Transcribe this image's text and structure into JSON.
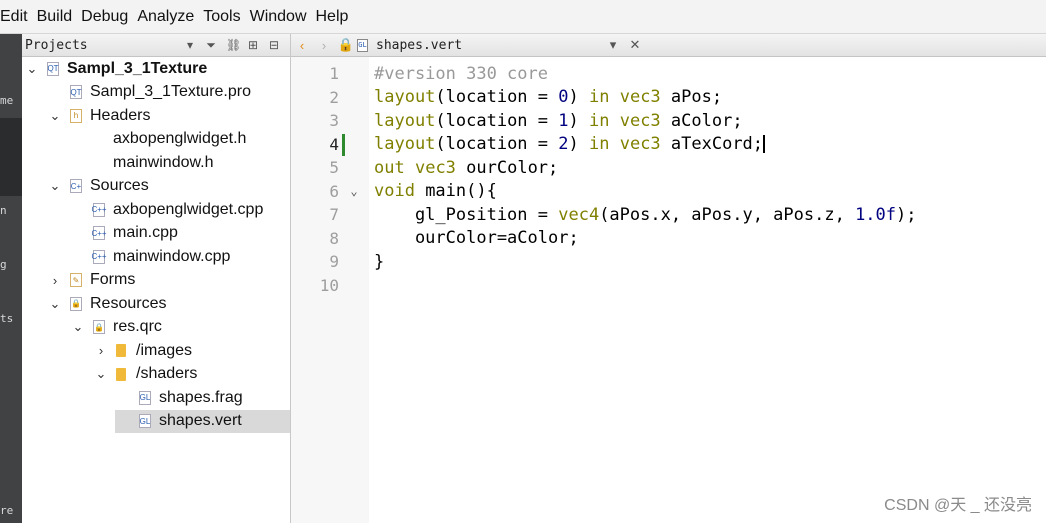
{
  "menu": [
    "Edit",
    "Build",
    "Debug",
    "Analyze",
    "Tools",
    "Window",
    "Help"
  ],
  "modes": [
    "me",
    "n",
    "g",
    "ts",
    "re"
  ],
  "projects_panel": {
    "title": "Projects",
    "tree": [
      {
        "level": 0,
        "arrow": "⌄",
        "icon": "project",
        "label": "Sampl_3_1Texture",
        "bold": true
      },
      {
        "level": 1,
        "arrow": "",
        "icon": "pro",
        "label": "Sampl_3_1Texture.pro"
      },
      {
        "level": 1,
        "arrow": "⌄",
        "icon": "header",
        "label": "Headers"
      },
      {
        "level": 2,
        "arrow": "",
        "icon": "",
        "label": "axbopenglwidget.h"
      },
      {
        "level": 2,
        "arrow": "",
        "icon": "",
        "label": "mainwindow.h"
      },
      {
        "level": 1,
        "arrow": "⌄",
        "icon": "source",
        "label": "Sources"
      },
      {
        "level": 2,
        "arrow": "",
        "icon": "cpp",
        "label": "axbopenglwidget.cpp"
      },
      {
        "level": 2,
        "arrow": "",
        "icon": "cpp",
        "label": "main.cpp"
      },
      {
        "level": 2,
        "arrow": "",
        "icon": "cpp",
        "label": "mainwindow.cpp"
      },
      {
        "level": 1,
        "arrow": "›",
        "icon": "forms",
        "label": "Forms"
      },
      {
        "level": 1,
        "arrow": "⌄",
        "icon": "resources",
        "label": "Resources"
      },
      {
        "level": 2,
        "arrow": "⌄",
        "icon": "qrc",
        "label": "res.qrc"
      },
      {
        "level": 3,
        "arrow": "›",
        "icon": "folder",
        "label": "/images"
      },
      {
        "level": 3,
        "arrow": "⌄",
        "icon": "folder",
        "label": "/shaders"
      },
      {
        "level": 4,
        "arrow": "",
        "icon": "gl",
        "label": "shapes.frag"
      },
      {
        "level": 4,
        "arrow": "",
        "icon": "gl",
        "label": "shapes.vert",
        "selected": true
      }
    ]
  },
  "editor": {
    "file_name": "shapes.vert",
    "lines": [
      {
        "n": "1",
        "html": "<span class=\"cmt\">#version 330 core</span>"
      },
      {
        "n": "2",
        "html": "<span class=\"kw\">layout</span>(location = <span class=\"num\">0</span>) <span class=\"kw\">in</span> <span class=\"kw\">vec3</span> aPos;"
      },
      {
        "n": "3",
        "html": "<span class=\"kw\">layout</span>(location = <span class=\"num\">1</span>) <span class=\"kw\">in</span> <span class=\"kw\">vec3</span> aColor;"
      },
      {
        "n": "4",
        "html": "<span class=\"kw\">layout</span>(location = <span class=\"num\">2</span>) <span class=\"kw\">in</span> <span class=\"kw\">vec3</span> aTexCord;<span class=\"cursor-caret\"></span>",
        "current": true
      },
      {
        "n": "5",
        "html": "<span class=\"kw\">out</span> <span class=\"kw\">vec3</span> ourColor;"
      },
      {
        "n": "6",
        "html": "<span class=\"kw\">void</span> main(){",
        "fold": true
      },
      {
        "n": "7",
        "html": "    gl_Position = <span class=\"kw\">vec4</span>(aPos.x, aPos.y, aPos.z, <span class=\"num\">1.0f</span>);"
      },
      {
        "n": "8",
        "html": "    ourColor=aColor;"
      },
      {
        "n": "9",
        "html": "}"
      },
      {
        "n": "10",
        "html": ""
      }
    ]
  },
  "watermark": "CSDN @天 _ 还没亮"
}
